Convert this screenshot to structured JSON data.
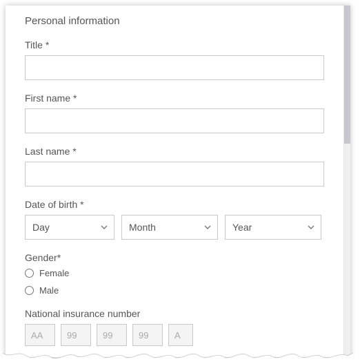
{
  "section_title": "Personal information",
  "fields": {
    "title": {
      "label": "Title *",
      "value": ""
    },
    "first_name": {
      "label": "First name *",
      "value": ""
    },
    "last_name": {
      "label": "Last name *",
      "value": ""
    },
    "dob": {
      "label": "Date of birth *",
      "day_label": "Day",
      "month_label": "Month",
      "year_label": "Year"
    },
    "gender": {
      "label": "Gender*",
      "options": {
        "female": "Female",
        "male": "Male"
      }
    },
    "nin": {
      "label": "National insurance number",
      "placeholders": {
        "p1": "AA",
        "p2": "99",
        "p3": "99",
        "p4": "99",
        "p5": "A"
      }
    }
  }
}
